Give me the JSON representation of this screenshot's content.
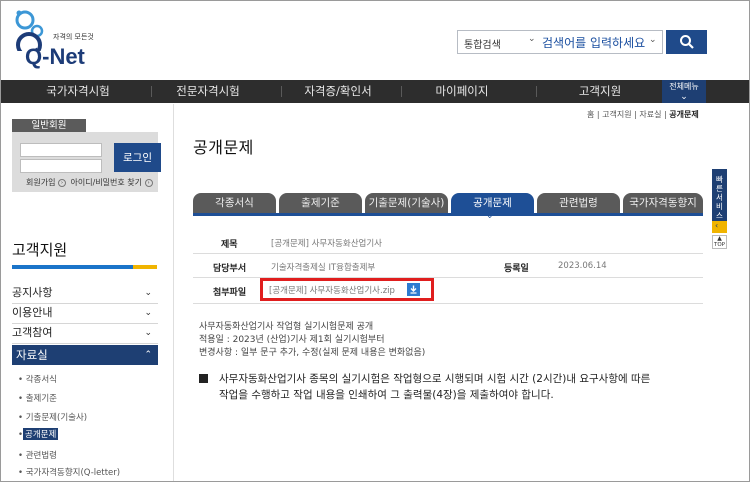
{
  "header": {
    "logo_tagline": "자격의 모든것",
    "logo_text": "Q-Net",
    "search_scope": "통합검색",
    "search_placeholder": "검색어를 입력하세요"
  },
  "gnb": {
    "items": [
      "국가자격시험",
      "전문자격시험",
      "자격증/확인서",
      "마이페이지",
      "고객지원"
    ],
    "all_menu": "전체메뉴"
  },
  "login": {
    "member_label": "일반회원",
    "login_button": "로그인",
    "signup": "회원가입",
    "find_account": "아이디/비밀번호 찾기"
  },
  "sidebar": {
    "title": "고객지원",
    "menu": [
      "공지사항",
      "이용안내",
      "고객참여"
    ],
    "active_menu": "자료실",
    "sub_items": [
      "각종서식",
      "출제기준",
      "기출문제(기술사)",
      "공개문제",
      "관련법령",
      "국가자격동향지(Q-letter)"
    ]
  },
  "breadcrumb": {
    "home": "홈",
    "level1": "고객지원",
    "level2": "자료실",
    "current": "공개문제"
  },
  "page": {
    "title": "공개문제"
  },
  "tabs": [
    "각종서식",
    "출제기준",
    "기출문제(기술사)",
    "공개문제",
    "관련법령",
    "국가자격동향지"
  ],
  "info": {
    "subject_label": "제목",
    "subject_value": "[공개문제] 사무자동화산업기사",
    "dept_label": "담당부서",
    "dept_value": "기술자격출제실 IT융합출제부",
    "date_label": "등록일",
    "date_value": "2023.06.14",
    "attach_label": "첨부파일",
    "attach_value": "[공개문제] 사무자동화산업기사.zip"
  },
  "content": {
    "line1": "사무자동화산업기사 작업형 실기시험문제 공개",
    "line2": "적용일 : 2023년 (산업)기사 제1회 실기시험부터",
    "line3": "변경사항 : 일부 문구 추가, 수정(실제 문제 내용은 변화없음)",
    "notice1": "사무자동화산업기사 종목의 실기시험은 작업형으로 시행되며 시험 시간 (2시간)내 요구사항에 따른",
    "notice2": "작업을 수행하고 작업 내용을 인쇄하여 그 출력물(4장)을   제출하여야   합니다."
  },
  "quick": {
    "label": "빠른서비스",
    "top": "TOP"
  },
  "colors": {
    "primary": "#1e3f73",
    "tab_active": "#1e4f96",
    "highlight": "#e01e1e",
    "accent": "#f0b400"
  }
}
